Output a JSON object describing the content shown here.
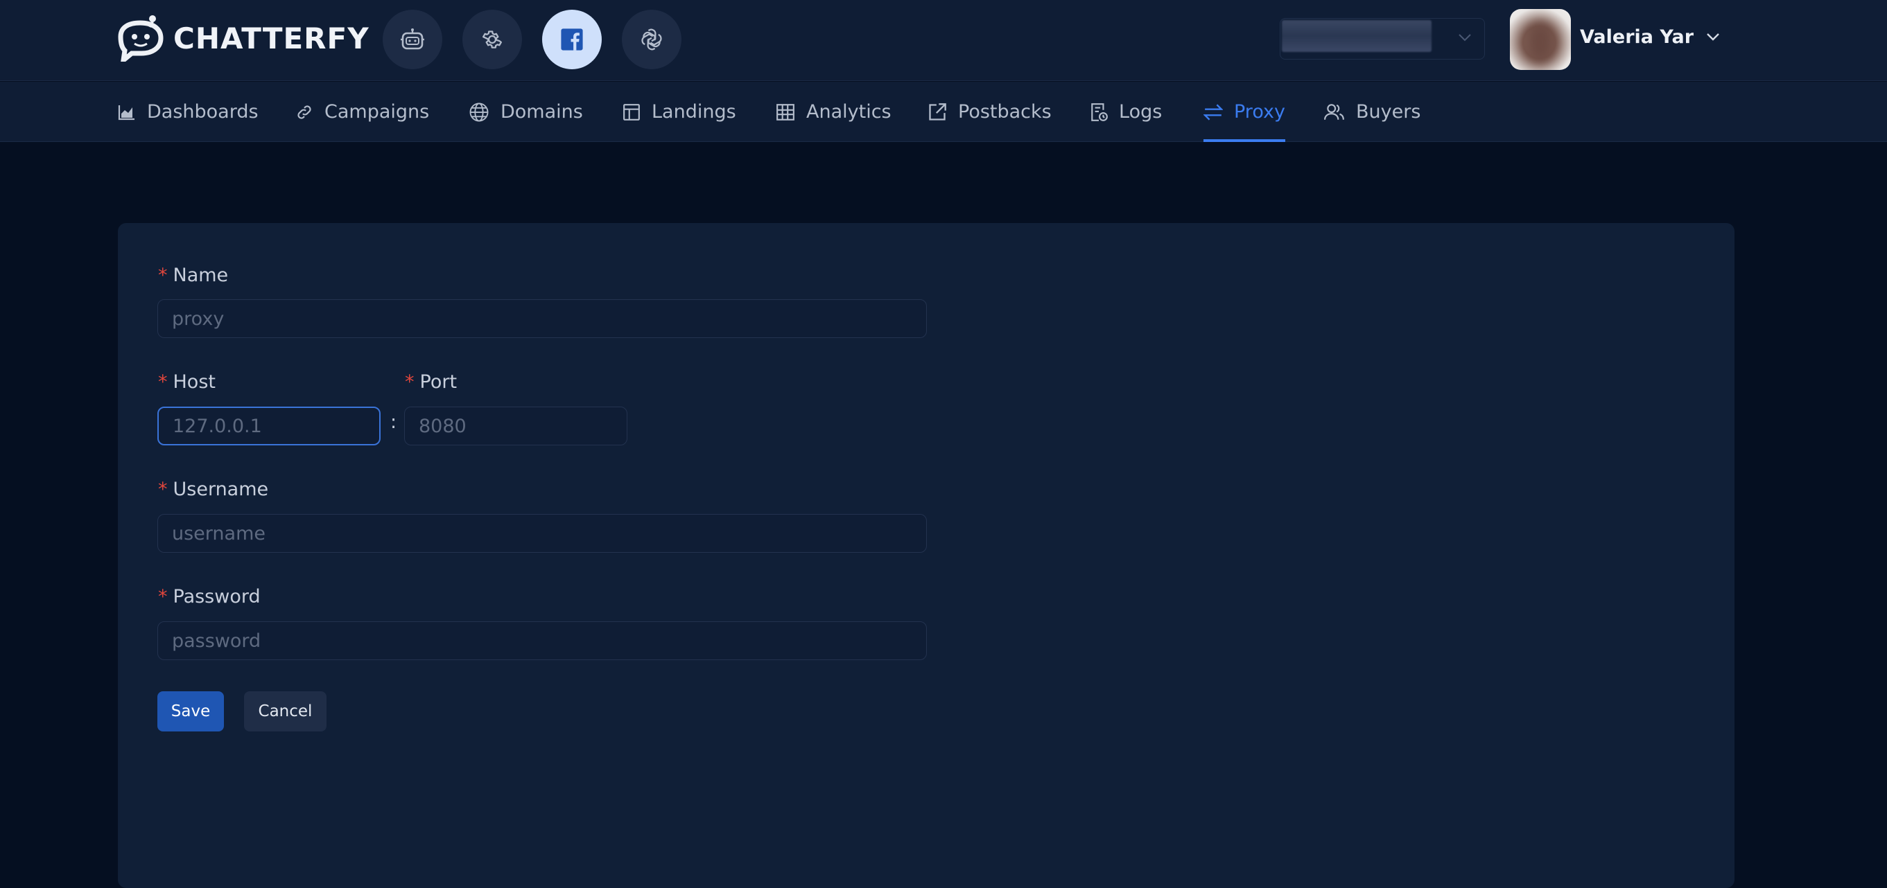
{
  "brand": {
    "name": "CHATTERFY"
  },
  "toolbar": {
    "buttons": [
      {
        "icon": "robot-icon"
      },
      {
        "icon": "gear-icon"
      },
      {
        "icon": "facebook-icon",
        "active": true
      },
      {
        "icon": "openai-icon"
      }
    ]
  },
  "user": {
    "name": "Valeria Yar"
  },
  "nav": {
    "items": [
      {
        "label": "Dashboards",
        "icon": "chart-icon"
      },
      {
        "label": "Campaigns",
        "icon": "link-icon"
      },
      {
        "label": "Domains",
        "icon": "globe-icon"
      },
      {
        "label": "Landings",
        "icon": "layout-icon"
      },
      {
        "label": "Analytics",
        "icon": "table-icon"
      },
      {
        "label": "Postbacks",
        "icon": "external-link-icon"
      },
      {
        "label": "Logs",
        "icon": "log-file-icon"
      },
      {
        "label": "Proxy",
        "icon": "swap-icon",
        "active": true
      },
      {
        "label": "Buyers",
        "icon": "users-icon"
      }
    ]
  },
  "form": {
    "name": {
      "label": "Name",
      "placeholder": "proxy"
    },
    "host": {
      "label": "Host",
      "placeholder": "127.0.0.1"
    },
    "separator": ":",
    "port": {
      "label": "Port",
      "placeholder": "8080"
    },
    "username": {
      "label": "Username",
      "placeholder": "username"
    },
    "password": {
      "label": "Password",
      "placeholder": "password"
    },
    "required_mark": "*",
    "save_label": "Save",
    "cancel_label": "Cancel"
  },
  "colors": {
    "accent": "#3b7cf0",
    "primary_button": "#1f56b3",
    "required": "#e0463c",
    "background": "#050f21",
    "panel": "#101f37"
  }
}
